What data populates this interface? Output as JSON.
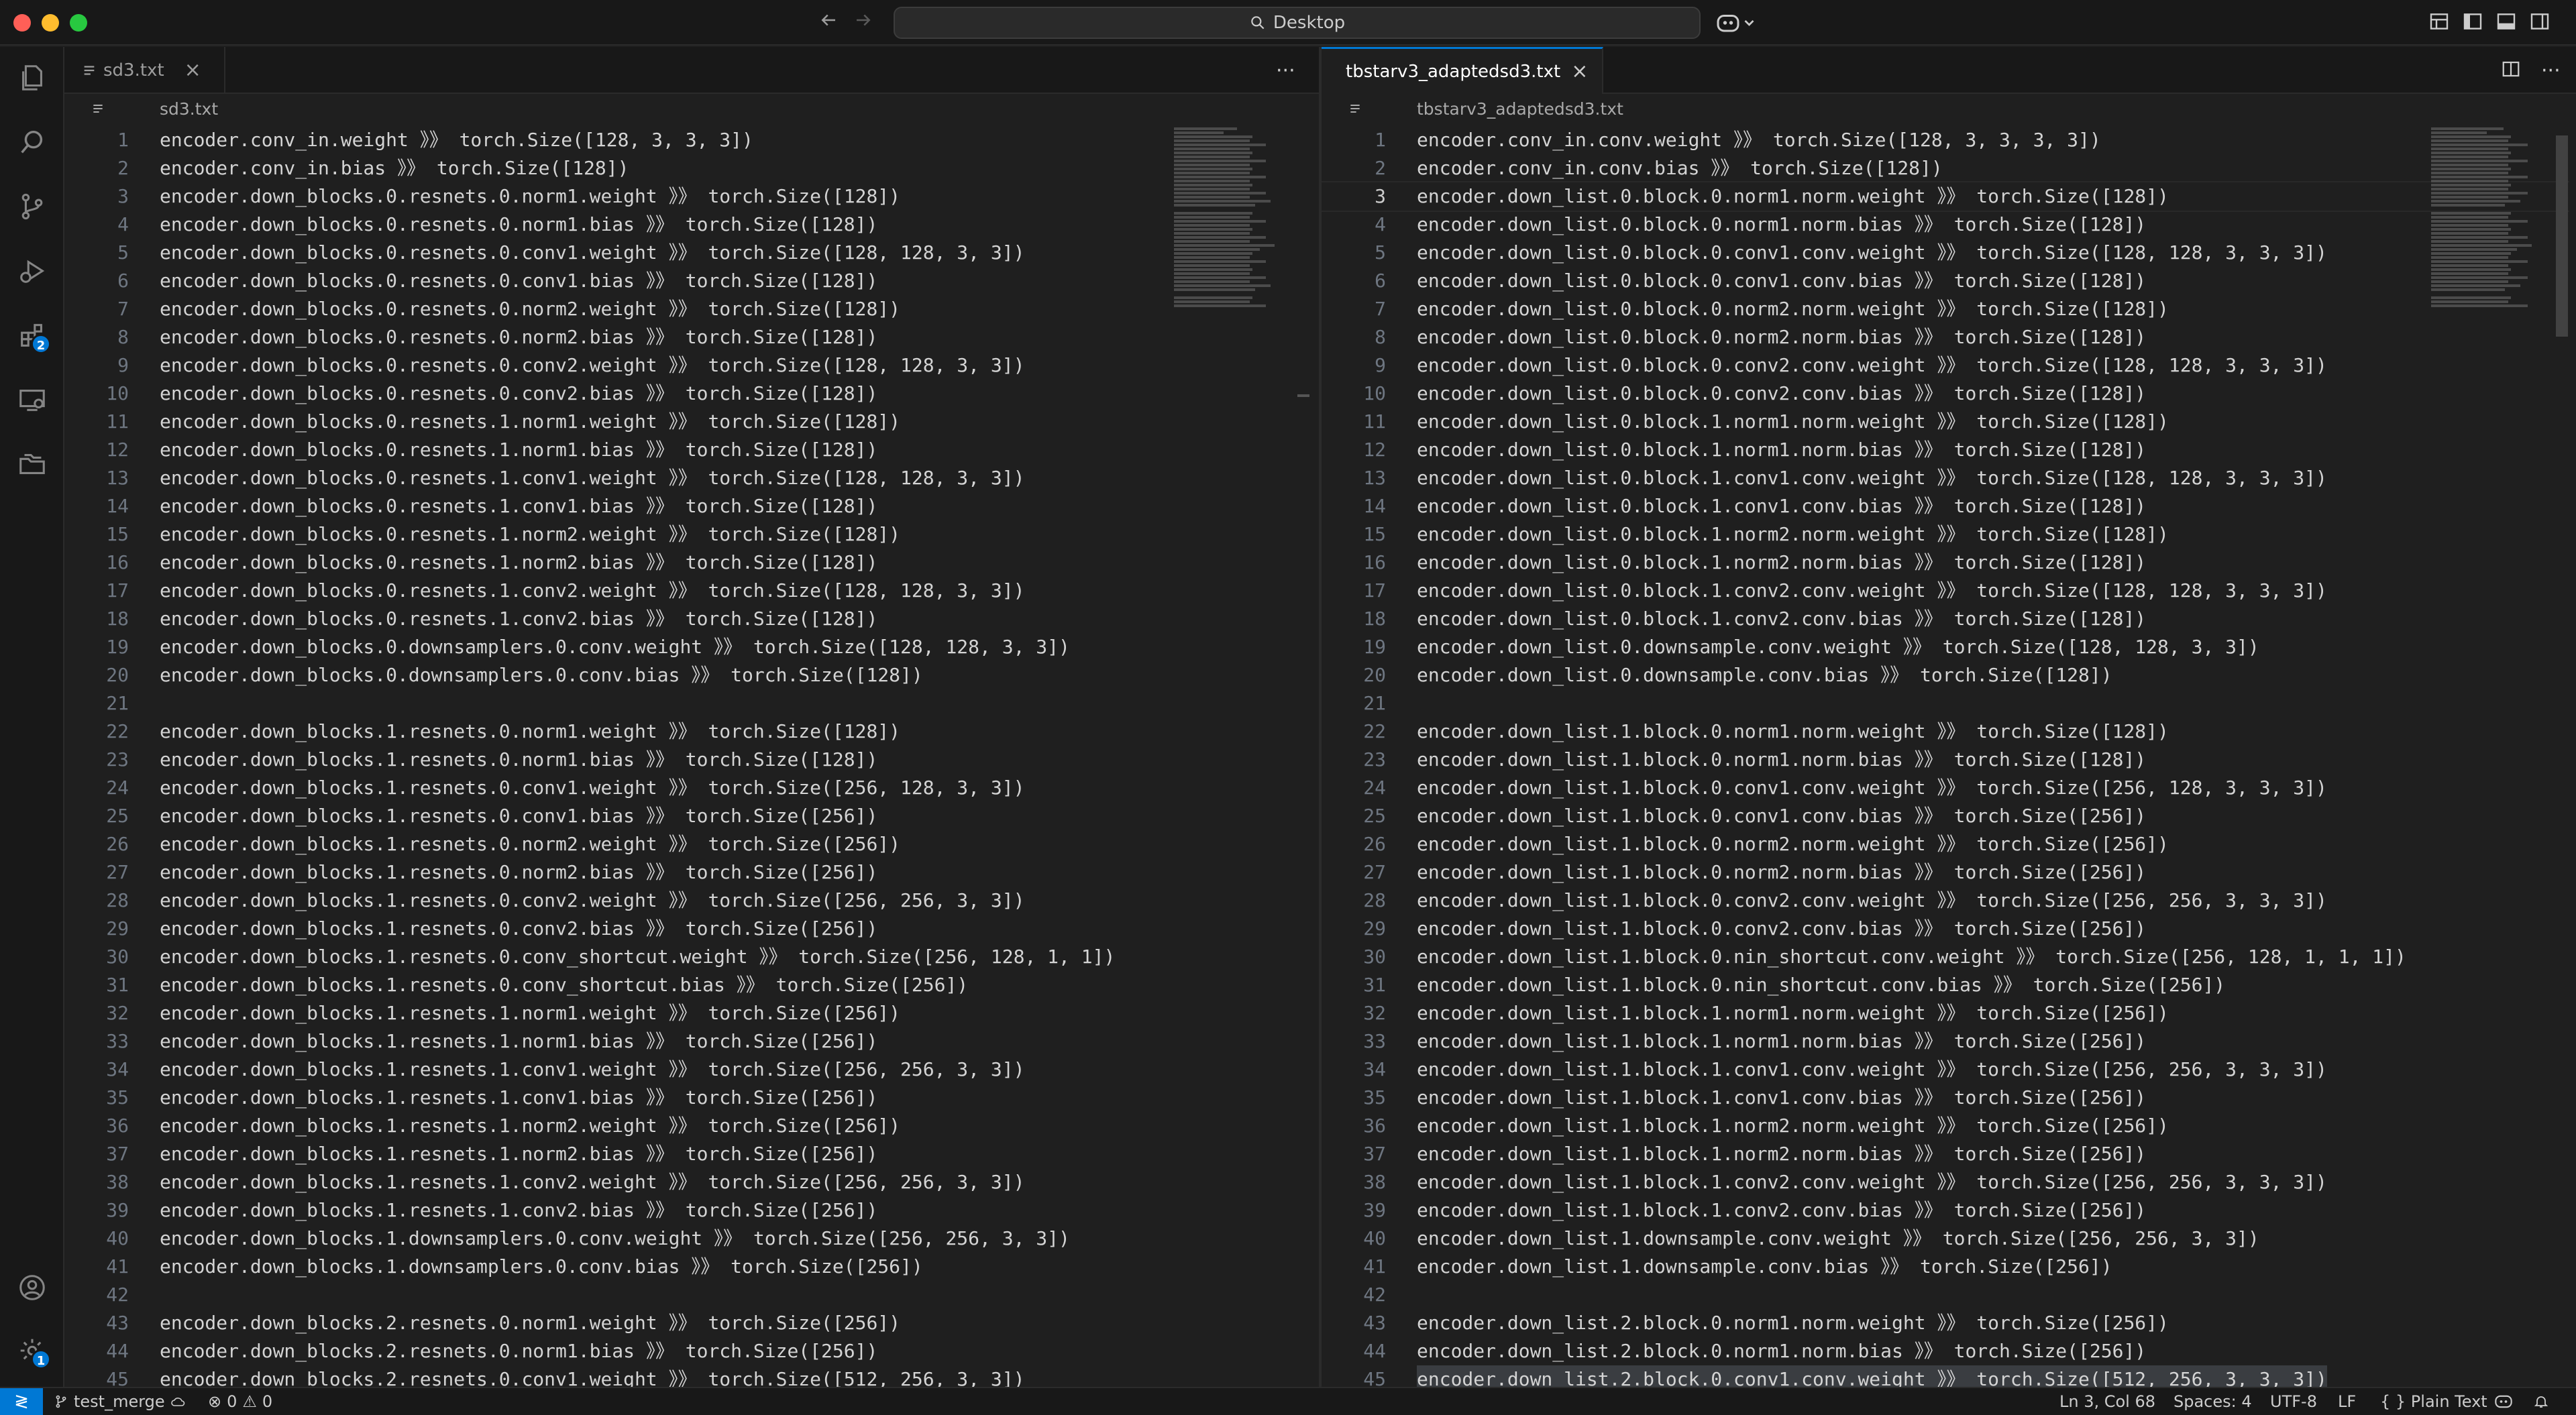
{
  "window": {
    "search_label": "Desktop",
    "traffic_colors": [
      "#ff5f57",
      "#febc2e",
      "#28c840"
    ]
  },
  "activity_bar": {
    "items": [
      "explorer-icon",
      "search-icon",
      "source-control-icon",
      "run-debug-icon",
      "extensions-icon",
      "remote-explorer-icon",
      "folders-icon"
    ],
    "extensions_badge": "2",
    "accounts": "account-icon",
    "manage": "gear-icon",
    "manage_badge": "1"
  },
  "left_editor": {
    "tab_label": "sd3.txt",
    "breadcrumb": "sd3.txt",
    "lines": [
      "encoder.conv_in.weight 》》 torch.Size([128, 3, 3, 3])",
      "encoder.conv_in.bias 》》 torch.Size([128])",
      "encoder.down_blocks.0.resnets.0.norm1.weight 》》 torch.Size([128])",
      "encoder.down_blocks.0.resnets.0.norm1.bias 》》 torch.Size([128])",
      "encoder.down_blocks.0.resnets.0.conv1.weight 》》 torch.Size([128, 128, 3, 3])",
      "encoder.down_blocks.0.resnets.0.conv1.bias 》》 torch.Size([128])",
      "encoder.down_blocks.0.resnets.0.norm2.weight 》》 torch.Size([128])",
      "encoder.down_blocks.0.resnets.0.norm2.bias 》》 torch.Size([128])",
      "encoder.down_blocks.0.resnets.0.conv2.weight 》》 torch.Size([128, 128, 3, 3])",
      "encoder.down_blocks.0.resnets.0.conv2.bias 》》 torch.Size([128])",
      "encoder.down_blocks.0.resnets.1.norm1.weight 》》 torch.Size([128])",
      "encoder.down_blocks.0.resnets.1.norm1.bias 》》 torch.Size([128])",
      "encoder.down_blocks.0.resnets.1.conv1.weight 》》 torch.Size([128, 128, 3, 3])",
      "encoder.down_blocks.0.resnets.1.conv1.bias 》》 torch.Size([128])",
      "encoder.down_blocks.0.resnets.1.norm2.weight 》》 torch.Size([128])",
      "encoder.down_blocks.0.resnets.1.norm2.bias 》》 torch.Size([128])",
      "encoder.down_blocks.0.resnets.1.conv2.weight 》》 torch.Size([128, 128, 3, 3])",
      "encoder.down_blocks.0.resnets.1.conv2.bias 》》 torch.Size([128])",
      "encoder.down_blocks.0.downsamplers.0.conv.weight 》》 torch.Size([128, 128, 3, 3])",
      "encoder.down_blocks.0.downsamplers.0.conv.bias 》》 torch.Size([128])",
      "",
      "encoder.down_blocks.1.resnets.0.norm1.weight 》》 torch.Size([128])",
      "encoder.down_blocks.1.resnets.0.norm1.bias 》》 torch.Size([128])",
      "encoder.down_blocks.1.resnets.0.conv1.weight 》》 torch.Size([256, 128, 3, 3])",
      "encoder.down_blocks.1.resnets.0.conv1.bias 》》 torch.Size([256])",
      "encoder.down_blocks.1.resnets.0.norm2.weight 》》 torch.Size([256])",
      "encoder.down_blocks.1.resnets.0.norm2.bias 》》 torch.Size([256])",
      "encoder.down_blocks.1.resnets.0.conv2.weight 》》 torch.Size([256, 256, 3, 3])",
      "encoder.down_blocks.1.resnets.0.conv2.bias 》》 torch.Size([256])",
      "encoder.down_blocks.1.resnets.0.conv_shortcut.weight 》》 torch.Size([256, 128, 1, 1])",
      "encoder.down_blocks.1.resnets.0.conv_shortcut.bias 》》 torch.Size([256])",
      "encoder.down_blocks.1.resnets.1.norm1.weight 》》 torch.Size([256])",
      "encoder.down_blocks.1.resnets.1.norm1.bias 》》 torch.Size([256])",
      "encoder.down_blocks.1.resnets.1.conv1.weight 》》 torch.Size([256, 256, 3, 3])",
      "encoder.down_blocks.1.resnets.1.conv1.bias 》》 torch.Size([256])",
      "encoder.down_blocks.1.resnets.1.norm2.weight 》》 torch.Size([256])",
      "encoder.down_blocks.1.resnets.1.norm2.bias 》》 torch.Size([256])",
      "encoder.down_blocks.1.resnets.1.conv2.weight 》》 torch.Size([256, 256, 3, 3])",
      "encoder.down_blocks.1.resnets.1.conv2.bias 》》 torch.Size([256])",
      "encoder.down_blocks.1.downsamplers.0.conv.weight 》》 torch.Size([256, 256, 3, 3])",
      "encoder.down_blocks.1.downsamplers.0.conv.bias 》》 torch.Size([256])",
      "",
      "encoder.down_blocks.2.resnets.0.norm1.weight 》》 torch.Size([256])",
      "encoder.down_blocks.2.resnets.0.norm1.bias 》》 torch.Size([256])",
      "encoder.down_blocks.2.resnets.0.conv1.weight 》》 torch.Size([512, 256, 3, 3])"
    ]
  },
  "right_editor": {
    "tab_label": "tbstarv3_adaptedsd3.txt",
    "breadcrumb": "tbstarv3_adaptedsd3.txt",
    "current_line": 3,
    "selected_line": 45,
    "lines": [
      "encoder.conv_in.conv.weight 》》 torch.Size([128, 3, 3, 3, 3])",
      "encoder.conv_in.conv.bias 》》 torch.Size([128])",
      "encoder.down_list.0.block.0.norm1.norm.weight 》》 torch.Size([128])",
      "encoder.down_list.0.block.0.norm1.norm.bias 》》 torch.Size([128])",
      "encoder.down_list.0.block.0.conv1.conv.weight 》》 torch.Size([128, 128, 3, 3, 3])",
      "encoder.down_list.0.block.0.conv1.conv.bias 》》 torch.Size([128])",
      "encoder.down_list.0.block.0.norm2.norm.weight 》》 torch.Size([128])",
      "encoder.down_list.0.block.0.norm2.norm.bias 》》 torch.Size([128])",
      "encoder.down_list.0.block.0.conv2.conv.weight 》》 torch.Size([128, 128, 3, 3, 3])",
      "encoder.down_list.0.block.0.conv2.conv.bias 》》 torch.Size([128])",
      "encoder.down_list.0.block.1.norm1.norm.weight 》》 torch.Size([128])",
      "encoder.down_list.0.block.1.norm1.norm.bias 》》 torch.Size([128])",
      "encoder.down_list.0.block.1.conv1.conv.weight 》》 torch.Size([128, 128, 3, 3, 3])",
      "encoder.down_list.0.block.1.conv1.conv.bias 》》 torch.Size([128])",
      "encoder.down_list.0.block.1.norm2.norm.weight 》》 torch.Size([128])",
      "encoder.down_list.0.block.1.norm2.norm.bias 》》 torch.Size([128])",
      "encoder.down_list.0.block.1.conv2.conv.weight 》》 torch.Size([128, 128, 3, 3, 3])",
      "encoder.down_list.0.block.1.conv2.conv.bias 》》 torch.Size([128])",
      "encoder.down_list.0.downsample.conv.weight 》》 torch.Size([128, 128, 3, 3])",
      "encoder.down_list.0.downsample.conv.bias 》》 torch.Size([128])",
      "",
      "encoder.down_list.1.block.0.norm1.norm.weight 》》 torch.Size([128])",
      "encoder.down_list.1.block.0.norm1.norm.bias 》》 torch.Size([128])",
      "encoder.down_list.1.block.0.conv1.conv.weight 》》 torch.Size([256, 128, 3, 3, 3])",
      "encoder.down_list.1.block.0.conv1.conv.bias 》》 torch.Size([256])",
      "encoder.down_list.1.block.0.norm2.norm.weight 》》 torch.Size([256])",
      "encoder.down_list.1.block.0.norm2.norm.bias 》》 torch.Size([256])",
      "encoder.down_list.1.block.0.conv2.conv.weight 》》 torch.Size([256, 256, 3, 3, 3])",
      "encoder.down_list.1.block.0.conv2.conv.bias 》》 torch.Size([256])",
      "encoder.down_list.1.block.0.nin_shortcut.conv.weight 》》 torch.Size([256, 128, 1, 1, 1])",
      "encoder.down_list.1.block.0.nin_shortcut.conv.bias 》》 torch.Size([256])",
      "encoder.down_list.1.block.1.norm1.norm.weight 》》 torch.Size([256])",
      "encoder.down_list.1.block.1.norm1.norm.bias 》》 torch.Size([256])",
      "encoder.down_list.1.block.1.conv1.conv.weight 》》 torch.Size([256, 256, 3, 3, 3])",
      "encoder.down_list.1.block.1.conv1.conv.bias 》》 torch.Size([256])",
      "encoder.down_list.1.block.1.norm2.norm.weight 》》 torch.Size([256])",
      "encoder.down_list.1.block.1.norm2.norm.bias 》》 torch.Size([256])",
      "encoder.down_list.1.block.1.conv2.conv.weight 》》 torch.Size([256, 256, 3, 3, 3])",
      "encoder.down_list.1.block.1.conv2.conv.bias 》》 torch.Size([256])",
      "encoder.down_list.1.downsample.conv.weight 》》 torch.Size([256, 256, 3, 3])",
      "encoder.down_list.1.downsample.conv.bias 》》 torch.Size([256])",
      "",
      "encoder.down_list.2.block.0.norm1.norm.weight 》》 torch.Size([256])",
      "encoder.down_list.2.block.0.norm1.norm.bias 》》 torch.Size([256])",
      "encoder.down_list.2.block.0.conv1.conv.weight 》》 torch.Size([512, 256, 3, 3, 3])"
    ]
  },
  "status_bar": {
    "branch": "test_merge",
    "errors": "0",
    "warnings": "0",
    "cursor": "Ln 3, Col 68",
    "indent": "Spaces: 4",
    "encoding": "UTF-8",
    "eol": "LF",
    "language": "{ } Plain Text",
    "accent_color": "#0078d4"
  }
}
